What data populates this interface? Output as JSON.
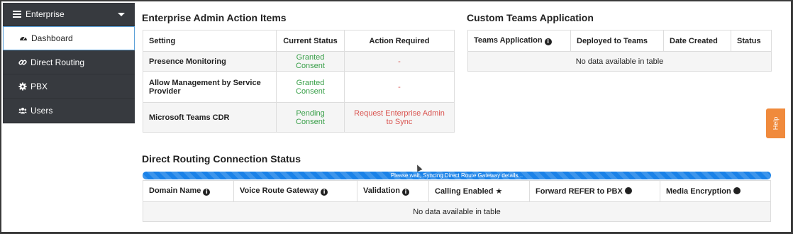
{
  "sidebar": {
    "header_label": "Enterprise",
    "items": [
      {
        "label": "Dashboard",
        "icon": "dashboard-icon"
      },
      {
        "label": "Direct Routing",
        "icon": "link-icon"
      },
      {
        "label": "PBX",
        "icon": "gear-icon"
      },
      {
        "label": "Users",
        "icon": "users-icon"
      }
    ]
  },
  "admin_items": {
    "title": "Enterprise Admin Action Items",
    "headers": [
      "Setting",
      "Current Status",
      "Action Required"
    ],
    "rows": [
      {
        "setting": "Presence Monitoring",
        "status": "Granted Consent",
        "action": "-"
      },
      {
        "setting": "Allow Management by Service Provider",
        "status": "Granted Consent",
        "action": "-"
      },
      {
        "setting": "Microsoft Teams CDR",
        "status": "Pending Consent",
        "action": "Request Enterprise Admin to Sync"
      }
    ]
  },
  "teams_app": {
    "title": "Custom Teams Application",
    "headers": [
      "Teams Application",
      "Deployed to Teams",
      "Date Created",
      "Status"
    ],
    "empty_text": "No data available in table"
  },
  "direct_routing": {
    "title": "Direct Routing Connection Status",
    "progress_text": "Please wait, Syncing Direct Route Gateway details...",
    "headers": [
      "Domain Name",
      "Voice Route Gateway",
      "Validation",
      "Calling Enabled",
      "Forward REFER to PBX",
      "Media Encryption"
    ],
    "empty_text": "No data available in table"
  },
  "help_label": "Help",
  "colors": {
    "sidebar_bg": "#373a3f",
    "granted": "#3aa04a",
    "pending": "#3aa04a",
    "action_red": "#d9534f",
    "progress": "#1a82e8",
    "help": "#f08a3c"
  }
}
